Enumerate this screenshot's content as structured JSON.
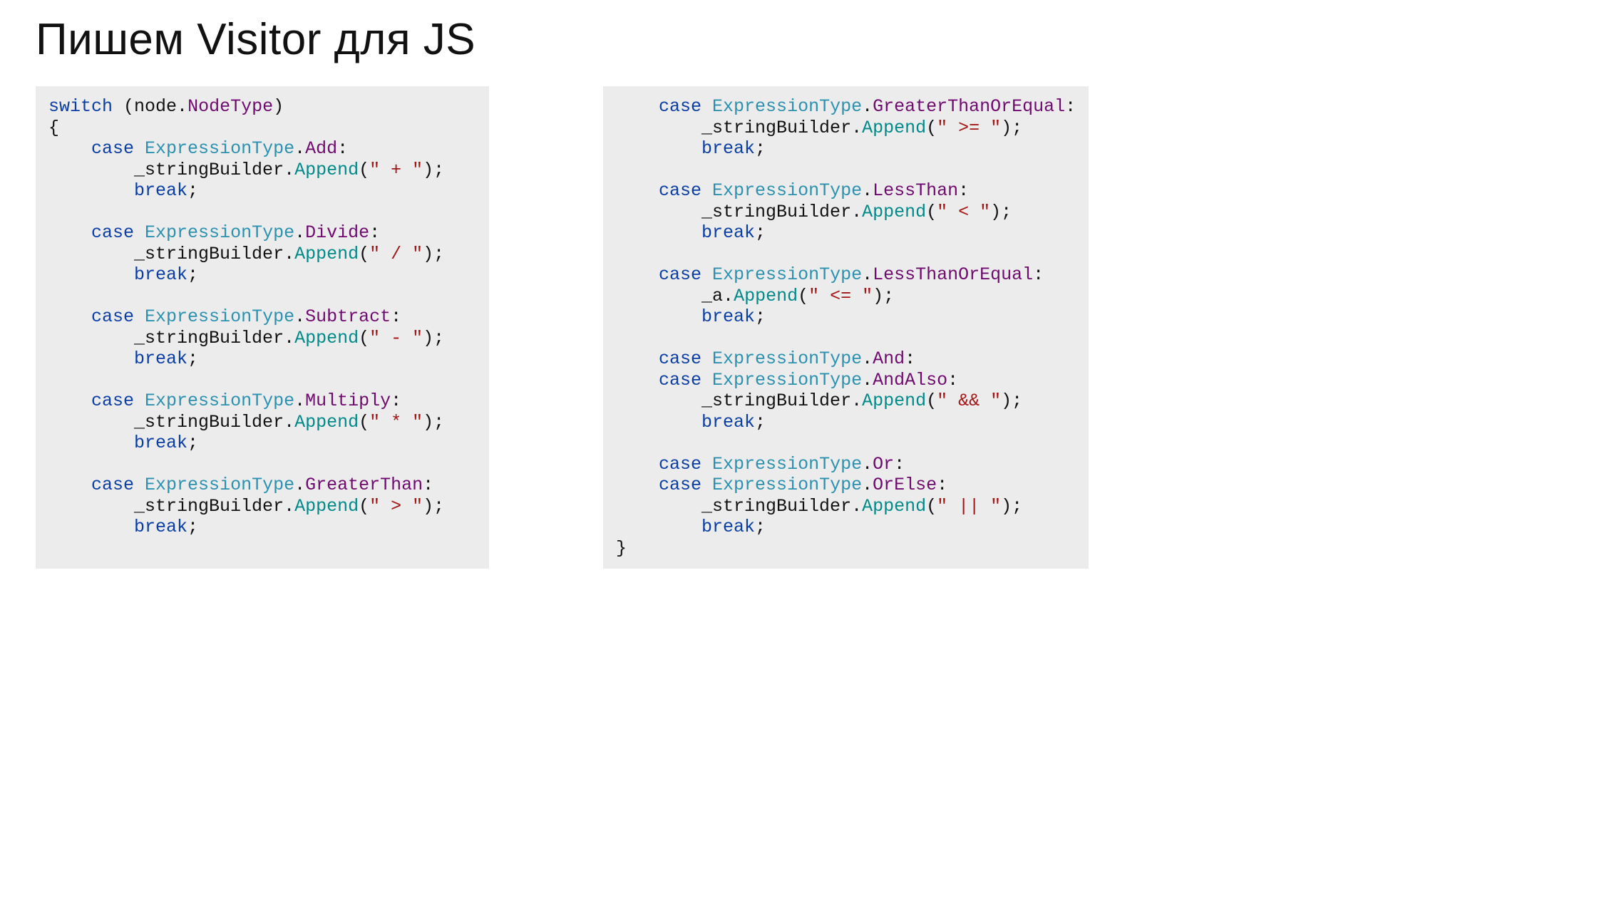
{
  "title": "Пишем Visitor для JS",
  "left": {
    "switchKw": "switch",
    "nodeExpr": "node",
    "nodeTypeProp": "NodeType",
    "sb": "_stringBuilder",
    "append": "Append",
    "breakKw": "break",
    "caseKw": "case",
    "exprType": "ExpressionType",
    "cases": {
      "add": {
        "member": "Add",
        "str": "\" + \""
      },
      "divide": {
        "member": "Divide",
        "str": "\" / \""
      },
      "subtract": {
        "member": "Subtract",
        "str": "\" - \""
      },
      "multiply": {
        "member": "Multiply",
        "str": "\" * \""
      },
      "gt": {
        "member": "GreaterThan",
        "str": "\" > \""
      }
    }
  },
  "right": {
    "sb": "_stringBuilder",
    "sbShort": "_a",
    "append": "Append",
    "breakKw": "break",
    "caseKw": "case",
    "exprType": "ExpressionType",
    "cases": {
      "gte": {
        "member": "GreaterThanOrEqual",
        "str": "\" >= \""
      },
      "lt": {
        "member": "LessThan",
        "str": "\" < \""
      },
      "lte": {
        "member": "LessThanOrEqual",
        "str": "\" <= \""
      },
      "and": {
        "member": "And"
      },
      "andAlso": {
        "member": "AndAlso",
        "str": "\" && \""
      },
      "or": {
        "member": "Or"
      },
      "orElse": {
        "member": "OrElse",
        "str": "\" || \""
      }
    }
  }
}
